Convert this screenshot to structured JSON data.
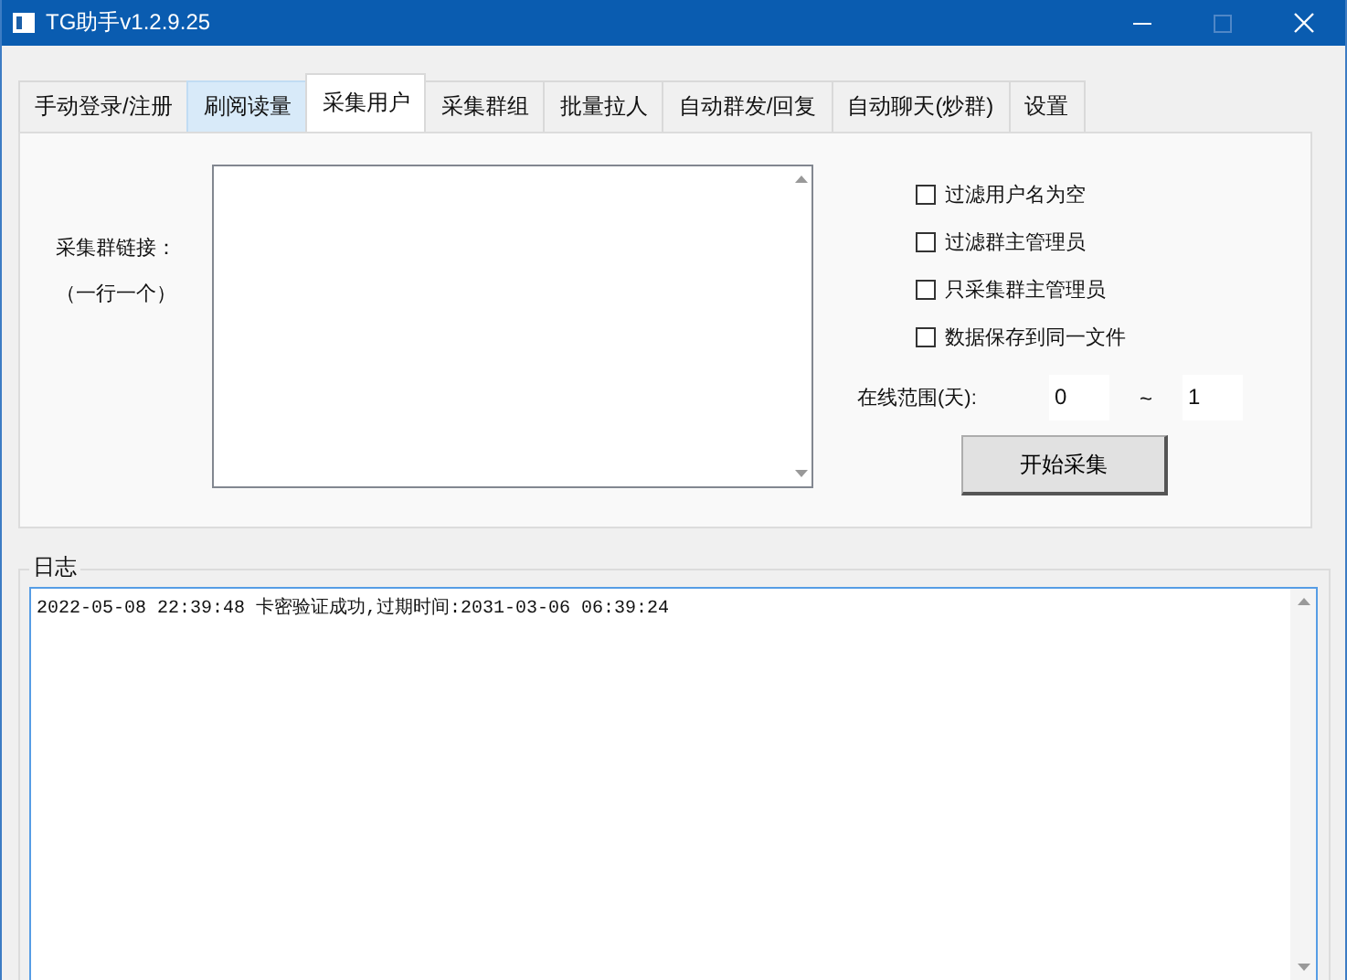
{
  "window": {
    "title": "TG助手v1.2.9.25"
  },
  "tabs": [
    {
      "label": "手动登录/注册",
      "selected": false,
      "hovered": false
    },
    {
      "label": "刷阅读量",
      "selected": false,
      "hovered": true
    },
    {
      "label": "采集用户",
      "selected": true,
      "hovered": false
    },
    {
      "label": "采集群组",
      "selected": false,
      "hovered": false
    },
    {
      "label": "批量拉人",
      "selected": false,
      "hovered": false
    },
    {
      "label": "自动群发/回复",
      "selected": false,
      "hovered": false
    },
    {
      "label": "自动聊天(炒群)",
      "selected": false,
      "hovered": false
    },
    {
      "label": "设置",
      "selected": false,
      "hovered": false
    }
  ],
  "collect": {
    "link_label": "采集群链接：",
    "link_hint": "（一行一个）",
    "options": [
      {
        "label": "过滤用户名为空",
        "checked": false
      },
      {
        "label": "过滤群主管理员",
        "checked": false
      },
      {
        "label": "只采集群主管理员",
        "checked": false
      },
      {
        "label": "数据保存到同一文件",
        "checked": false
      }
    ],
    "online_range": {
      "label": "在线范围(天):",
      "from": "0",
      "separator": "~",
      "to": "1"
    },
    "start_button": "开始采集"
  },
  "log": {
    "title": "日志",
    "lines": [
      "2022-05-08 22:39:48 卡密验证成功,过期时间:2031-03-06 06:39:24"
    ]
  }
}
